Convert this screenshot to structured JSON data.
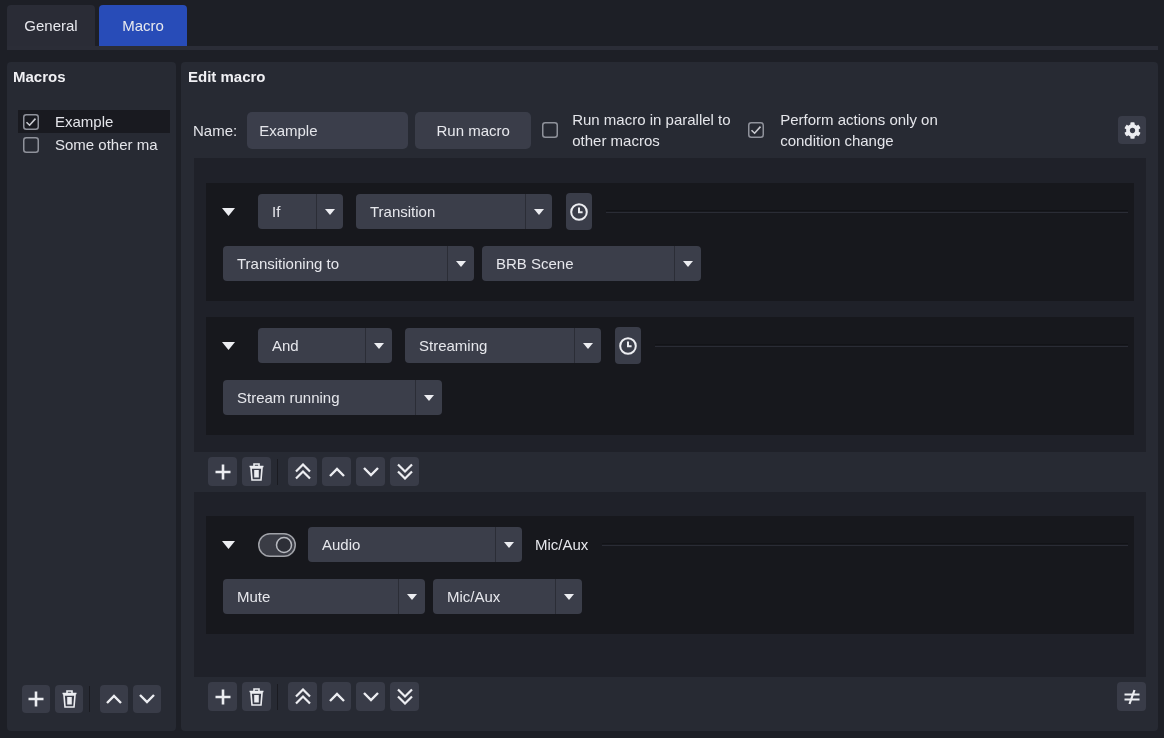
{
  "tabs": [
    {
      "label": "General",
      "selected": false
    },
    {
      "label": "Macro",
      "selected": true
    }
  ],
  "macros_panel": {
    "title": "Macros",
    "items": [
      {
        "label": "Example",
        "checked": true,
        "selected": true
      },
      {
        "label": "Some other ma",
        "checked": false,
        "selected": false
      }
    ]
  },
  "edit_macro": {
    "title": "Edit macro",
    "name_label": "Name:",
    "name_value": "Example",
    "run_button": "Run macro",
    "options": [
      {
        "label": "Run macro in parallel to other macros",
        "checked": false
      },
      {
        "label": "Perform actions only on condition change",
        "checked": true
      }
    ],
    "conditions": [
      {
        "expanded": true,
        "logic": "If",
        "type": "Transition",
        "fields": [
          "Transitioning to",
          "BRB Scene"
        ]
      },
      {
        "expanded": true,
        "logic": "And",
        "type": "Streaming",
        "fields": [
          "Stream running"
        ]
      }
    ],
    "actions": [
      {
        "expanded": true,
        "enabled": true,
        "type": "Audio",
        "summary": "Mic/Aux",
        "fields": [
          "Mute",
          "Mic/Aux"
        ]
      }
    ]
  }
}
